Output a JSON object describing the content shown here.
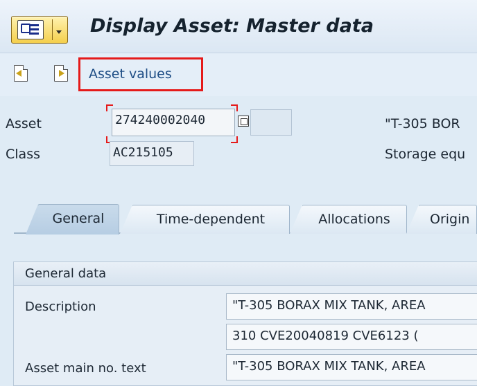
{
  "window": {
    "title": "Display Asset:  Master data"
  },
  "toolbar": {
    "asset_values_label": "Asset values"
  },
  "header": {
    "asset_label": "Asset",
    "asset_value": "274240002040",
    "subnumber_value": "",
    "asset_description": "\"T-305 BOR",
    "class_label": "Class",
    "class_value": "AC215105",
    "class_description": "Storage equ"
  },
  "tabs": [
    {
      "label": "General",
      "active": true
    },
    {
      "label": "Time-dependent",
      "active": false
    },
    {
      "label": "Allocations",
      "active": false
    },
    {
      "label": "Origin",
      "active": false
    }
  ],
  "general_data": {
    "title": "General data",
    "description_label": "Description",
    "description_line1": "\"T-305 BORAX MIX TANK, AREA",
    "description_line2": "310  CVE20040819  CVE6123 (",
    "main_text_label": "Asset main no. text",
    "main_text_value": "\"T-305 BORAX MIX TANK, AREA"
  },
  "colors": {
    "highlight_border": "#e51a1a",
    "link_text": "#1e4d85",
    "background": "#dfebf5"
  }
}
